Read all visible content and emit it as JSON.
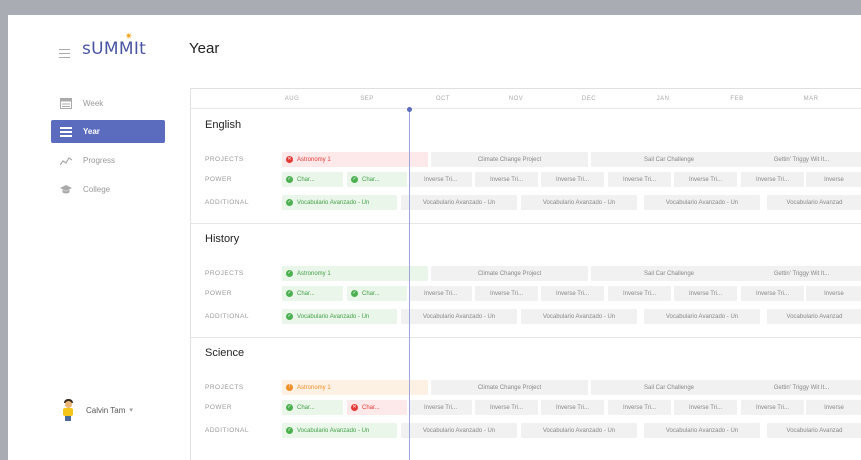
{
  "app": {
    "logo": "sUMMIt",
    "page_title": "Year"
  },
  "sidebar": {
    "items": [
      {
        "label": "Week",
        "icon": "calendar-week-icon"
      },
      {
        "label": "Year",
        "icon": "list-icon",
        "active": true
      },
      {
        "label": "Progress",
        "icon": "progress-chart-icon"
      },
      {
        "label": "College",
        "icon": "graduation-cap-icon"
      }
    ]
  },
  "user": {
    "name": "Calvin Tam",
    "caret": "▾"
  },
  "timeline": {
    "months": [
      "AUG",
      "SEP",
      "OCT",
      "NOV",
      "DEC",
      "JAN",
      "FEB",
      "MAR"
    ]
  },
  "row_labels": {
    "projects": "PROJECTS",
    "power": "POWER",
    "additional": "ADDITIONAL"
  },
  "sections": [
    {
      "title": "English",
      "projects": [
        {
          "label": "Astronomy 1",
          "status": "red"
        },
        {
          "label": "Climate Change Project"
        },
        {
          "label": "Sail Car Challenge"
        },
        {
          "label": "Gettin' Triggy Wit It..."
        }
      ],
      "power": [
        {
          "label": "Char...",
          "status": "green"
        },
        {
          "label": "Char...",
          "status": "green"
        },
        {
          "label": "Inverse Tri..."
        },
        {
          "label": "Inverse Tri..."
        },
        {
          "label": "Inverse Tri..."
        },
        {
          "label": "Inverse Tri..."
        },
        {
          "label": "Inverse Tri..."
        },
        {
          "label": "Inverse Tri..."
        },
        {
          "label": "Inverse"
        }
      ],
      "additional": [
        {
          "label": "Vocabulario Avanzado - Un",
          "status": "green"
        },
        {
          "label": "Vocabulario Avanzado - Un"
        },
        {
          "label": "Vocabulario Avanzado - Un"
        },
        {
          "label": "Vocabulario Avanzado - Un"
        },
        {
          "label": "Vocabulario Avanzad"
        }
      ]
    },
    {
      "title": "History",
      "projects": [
        {
          "label": "Astronomy 1",
          "status": "green"
        },
        {
          "label": "Climate Change Project"
        },
        {
          "label": "Sail Car Challenge"
        },
        {
          "label": "Gettin' Triggy Wit It..."
        }
      ],
      "power": [
        {
          "label": "Char...",
          "status": "green"
        },
        {
          "label": "Char...",
          "status": "green"
        },
        {
          "label": "Inverse Tri..."
        },
        {
          "label": "Inverse Tri..."
        },
        {
          "label": "Inverse Tri..."
        },
        {
          "label": "Inverse Tri..."
        },
        {
          "label": "Inverse Tri..."
        },
        {
          "label": "Inverse Tri..."
        },
        {
          "label": "Inverse"
        }
      ],
      "additional": [
        {
          "label": "Vocabulario Avanzado - Un",
          "status": "green"
        },
        {
          "label": "Vocabulario Avanzado - Un"
        },
        {
          "label": "Vocabulario Avanzado - Un"
        },
        {
          "label": "Vocabulario Avanzado - Un"
        },
        {
          "label": "Vocabulario Avanzad"
        }
      ]
    },
    {
      "title": "Science",
      "projects": [
        {
          "label": "Astronomy 1",
          "status": "orange"
        },
        {
          "label": "Climate Change Project"
        },
        {
          "label": "Sail Car Challenge"
        },
        {
          "label": "Gettin' Triggy Wit It..."
        }
      ],
      "power": [
        {
          "label": "Char...",
          "status": "green"
        },
        {
          "label": "Char...",
          "status": "red"
        },
        {
          "label": "Inverse Tri..."
        },
        {
          "label": "Inverse Tri..."
        },
        {
          "label": "Inverse Tri..."
        },
        {
          "label": "Inverse Tri..."
        },
        {
          "label": "Inverse Tri..."
        },
        {
          "label": "Inverse Tri..."
        },
        {
          "label": "Inverse"
        }
      ],
      "additional": [
        {
          "label": "Vocabulario Avanzado - Un",
          "status": "green"
        },
        {
          "label": "Vocabulario Avanzado - Un"
        },
        {
          "label": "Vocabulario Avanzado - Un"
        },
        {
          "label": "Vocabulario Avanzado - Un"
        },
        {
          "label": "Vocabulario Avanzad"
        }
      ]
    }
  ],
  "colors": {
    "accent": "#5b6bbd",
    "green": "#4caf50",
    "red": "#e53935",
    "orange": "#ef8f2a",
    "brand": "#4a55a2"
  }
}
